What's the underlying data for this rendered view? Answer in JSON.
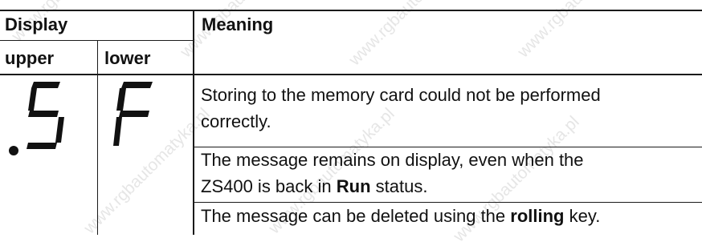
{
  "table": {
    "header": {
      "display": "Display",
      "meaning": "Meaning",
      "upper": "upper",
      "lower": "lower"
    },
    "row": {
      "upper_display": ".5",
      "lower_display": "F",
      "meaning_lines": [
        "Storing to the memory card could not be performed",
        "correctly."
      ],
      "para2_line1": "The message remains on display, even when the",
      "para2_line2_pre": "ZS400 is back in ",
      "para2_line2_bold": "Run",
      "para2_line2_post": " status.",
      "para3_pre": "The message can be deleted using the ",
      "para3_bold": "rolling",
      "para3_post": " key."
    }
  },
  "watermark": "www.rgbautomatyka.pl"
}
